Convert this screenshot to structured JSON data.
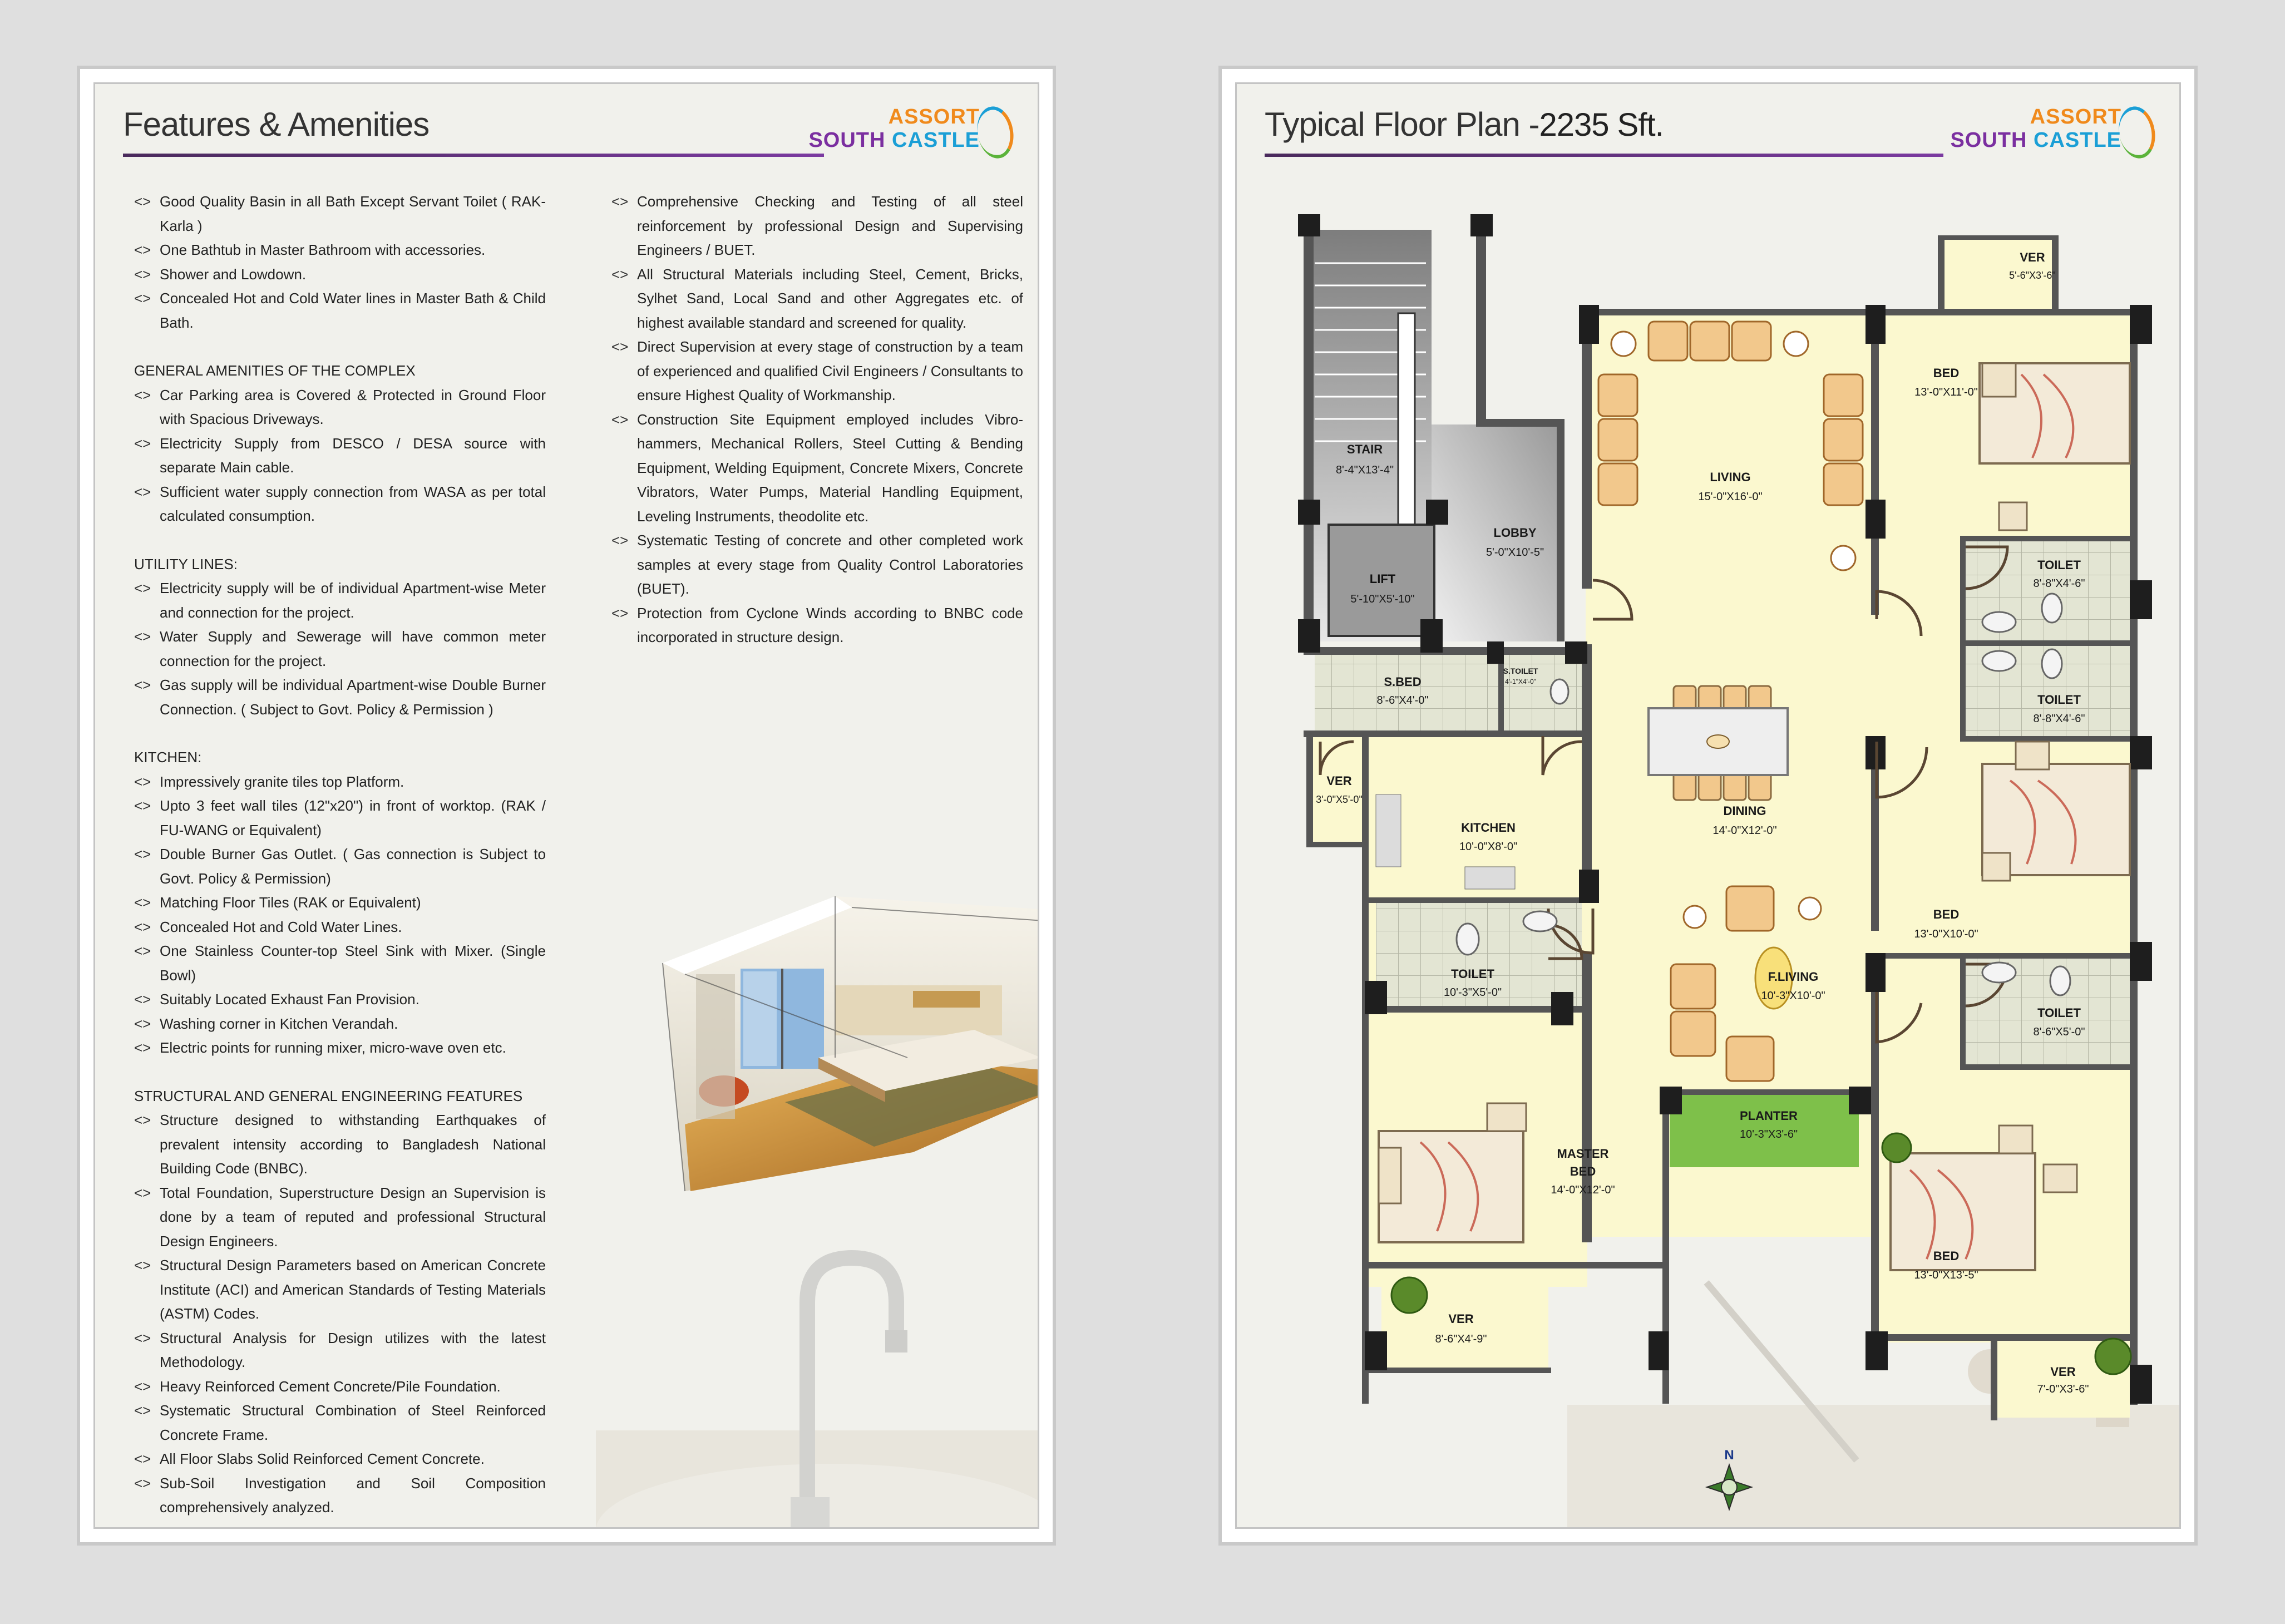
{
  "left": {
    "title": "Features & Amenities",
    "logo": {
      "top": "ASSORT",
      "bottom_a": "SOUTH",
      "bottom_b": "CASTLE"
    },
    "col1": [
      {
        "text": "Good Quality Basin in all Bath Except Servant Toilet ( RAK-Karla )"
      },
      {
        "text": "One Bathtub in Master Bathroom with accessories."
      },
      {
        "text": "Shower and Lowdown."
      },
      {
        "text": "Concealed Hot and Cold Water lines in Master Bath & Child Bath."
      },
      {
        "heading": "GENERAL AMENITIES OF THE COMPLEX"
      },
      {
        "text": "Car Parking area is Covered & Protected in Ground Floor with Spacious Driveways."
      },
      {
        "text": "Electricity Supply from DESCO / DESA source with separate Main cable."
      },
      {
        "text": "Sufficient water supply connection from WASA as per total calculated consumption."
      },
      {
        "heading": "UTILITY LINES:"
      },
      {
        "text": "Electricity supply will be of individual Apartment-wise Meter and connection for the project."
      },
      {
        "text": "Water Supply and Sewerage will have common meter connection for the project."
      },
      {
        "text": "Gas supply will be individual Apartment-wise Double Burner Connection. ( Subject to Govt. Policy & Permission )"
      },
      {
        "heading": "KITCHEN:"
      },
      {
        "text": "Impressively granite tiles top Platform."
      },
      {
        "text": "Upto 3 feet wall tiles (12\"x20\") in front of worktop. (RAK / FU-WANG or Equivalent)"
      },
      {
        "text": "Double Burner Gas Outlet. ( Gas connection is Subject to Govt. Policy & Permission)"
      },
      {
        "text": "Matching Floor Tiles (RAK or Equivalent)"
      },
      {
        "text": "Concealed Hot and Cold Water Lines."
      },
      {
        "text": "One Stainless Counter-top Steel Sink with Mixer. (Single Bowl)"
      },
      {
        "text": "Suitably Located Exhaust Fan Provision."
      },
      {
        "text": "Washing corner in Kitchen Verandah."
      },
      {
        "text": "Electric points for running mixer, micro-wave oven etc."
      },
      {
        "heading": "STRUCTURAL AND GENERAL ENGINEERING FEATURES"
      },
      {
        "text": "Structure designed to withstanding Earthquakes of prevalent intensity according to Bangladesh National Building Code (BNBC)."
      },
      {
        "text": "Total Foundation, Superstructure Design an Supervision is done by a team of reputed and professional Structural Design Engineers."
      },
      {
        "text": "Structural Design Parameters based on American Concrete Institute (ACI) and American Standards of Testing Materials (ASTM) Codes."
      },
      {
        "text": "Structural Analysis for Design utilizes with the latest Methodology."
      },
      {
        "text": "Heavy Reinforced Cement Concrete/Pile Foundation."
      },
      {
        "text": "Systematic Structural Combination of Steel Reinforced Concrete Frame."
      },
      {
        "text": "All Floor Slabs Solid Reinforced Cement Concrete."
      },
      {
        "text": "Sub-Soil Investigation and Soil Composition comprehensively analyzed."
      }
    ],
    "col2": [
      {
        "text": "Comprehensive Checking and Testing of all steel reinforcement by professional Design and Supervising Engineers / BUET."
      },
      {
        "text": "All Structural Materials including Steel, Cement, Bricks, Sylhet Sand, Local Sand and other Aggregates etc. of highest available standard and screened for quality."
      },
      {
        "text": "Direct Supervision at every stage of construction by a team of experienced and qualified Civil Engineers / Consultants to ensure Highest Quality of Workmanship."
      },
      {
        "text": "Construction Site Equipment employed includes Vibro-hammers, Mechanical Rollers, Steel Cutting & Bending Equipment, Welding Equipment, Concrete Mixers, Concrete Vibrators, Water Pumps, Material Handling Equipment, Leveling Instruments, theodolite etc."
      },
      {
        "text": "Systematic Testing of concrete and other completed work samples at every stage from Quality Control Laboratories (BUET)."
      },
      {
        "text": "Protection from Cyclone Winds according to BNBC code incorporated in structure design."
      }
    ],
    "bullet": "<>"
  },
  "right": {
    "title": "Typical Floor Plan -",
    "area": "2235 Sft.",
    "logo": {
      "top": "ASSORT",
      "bottom_a": "SOUTH",
      "bottom_b": "CASTLE"
    },
    "compass": "N",
    "rooms": {
      "stair": {
        "name": "STAIR",
        "dim": "8'-4\"X13'-4\""
      },
      "lobby": {
        "name": "LOBBY",
        "dim": "5'-0\"X10'-5\""
      },
      "lift": {
        "name": "LIFT",
        "dim": "5'-10\"X5'-10\""
      },
      "living": {
        "name": "LIVING",
        "dim": "15'-0\"X16'-0\""
      },
      "sbed": {
        "name": "S.BED",
        "dim": "8'-6\"X4'-0\""
      },
      "stoilet": {
        "name": "S.TOILET",
        "dim": "4'-1\"X4'-0\""
      },
      "ver_left": {
        "name": "VER",
        "dim": "3'-0\"X5'-0\""
      },
      "kitchen": {
        "name": "KITCHEN",
        "dim": "10'-0\"X8'-0\""
      },
      "dining": {
        "name": "DINING",
        "dim": "14'-0\"X12'-0\""
      },
      "toilet_left": {
        "name": "TOILET",
        "dim": "10'-3\"X5'-0\""
      },
      "fliving": {
        "name": "F.LIVING",
        "dim": "10'-3\"X10'-0\""
      },
      "planter": {
        "name": "PLANTER",
        "dim": "10'-3\"X3'-6\""
      },
      "master": {
        "name1": "MASTER",
        "name2": "BED",
        "dim": "14'-0\"X12'-0\""
      },
      "ver_bottom_left": {
        "name": "VER",
        "dim": "8'-6\"X4'-9\""
      },
      "ver_top": {
        "name": "VER",
        "dim": "5'-6\"X3'-6\""
      },
      "bed1": {
        "name": "BED",
        "dim": "13'-0\"X11'-0\""
      },
      "toilet_r1": {
        "name": "TOILET",
        "dim": "8'-8\"X4'-6\""
      },
      "toilet_r2": {
        "name": "TOILET",
        "dim": "8'-8\"X4'-6\""
      },
      "bed2": {
        "name": "BED",
        "dim": "13'-0\"X10'-0\""
      },
      "toilet_r3": {
        "name": "TOILET",
        "dim": "8'-6\"X5'-0\""
      },
      "bed3": {
        "name": "BED",
        "dim": "13'-0\"X13'-5\""
      },
      "ver_bottom_right": {
        "name": "VER",
        "dim": "7'-0\"X3'-6\""
      }
    }
  }
}
